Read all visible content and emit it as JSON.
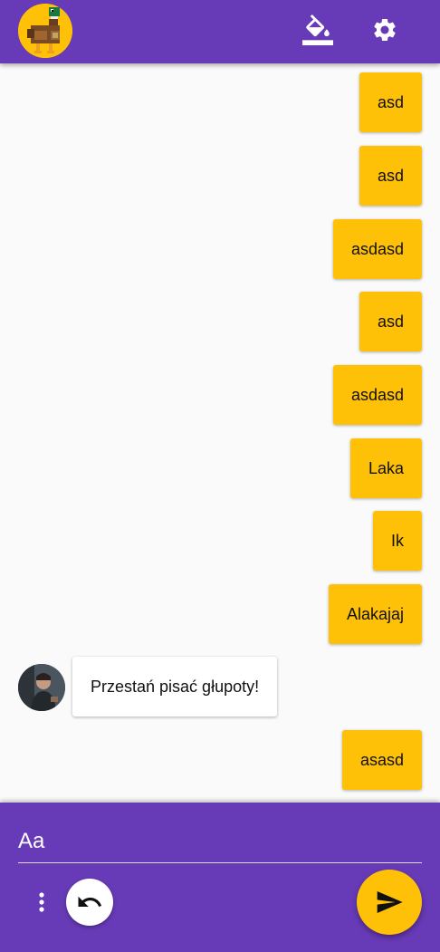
{
  "header": {
    "logo_icon": "duck-logo-icon",
    "actions": [
      {
        "icon": "paint-bucket-icon"
      },
      {
        "icon": "gear-icon"
      }
    ]
  },
  "messages": [
    {
      "direction": "outgoing",
      "text": "asd"
    },
    {
      "direction": "outgoing",
      "text": "asd"
    },
    {
      "direction": "outgoing",
      "text": "asdasd"
    },
    {
      "direction": "outgoing",
      "text": "asd"
    },
    {
      "direction": "outgoing",
      "text": "asdasd"
    },
    {
      "direction": "outgoing",
      "text": "Laka"
    },
    {
      "direction": "outgoing",
      "text": "Ik"
    },
    {
      "direction": "outgoing",
      "text": "Alakajaj"
    },
    {
      "direction": "incoming",
      "text": "Przestań pisać głupoty!"
    },
    {
      "direction": "outgoing",
      "text": "asasd"
    }
  ],
  "composer": {
    "placeholder": "Aa",
    "value": "",
    "more_icon": "more-vertical-icon",
    "undo_icon": "undo-icon",
    "send_icon": "send-icon"
  },
  "colors": {
    "primary": "#673ab7",
    "accent": "#ffc107",
    "background": "#fafafa"
  }
}
